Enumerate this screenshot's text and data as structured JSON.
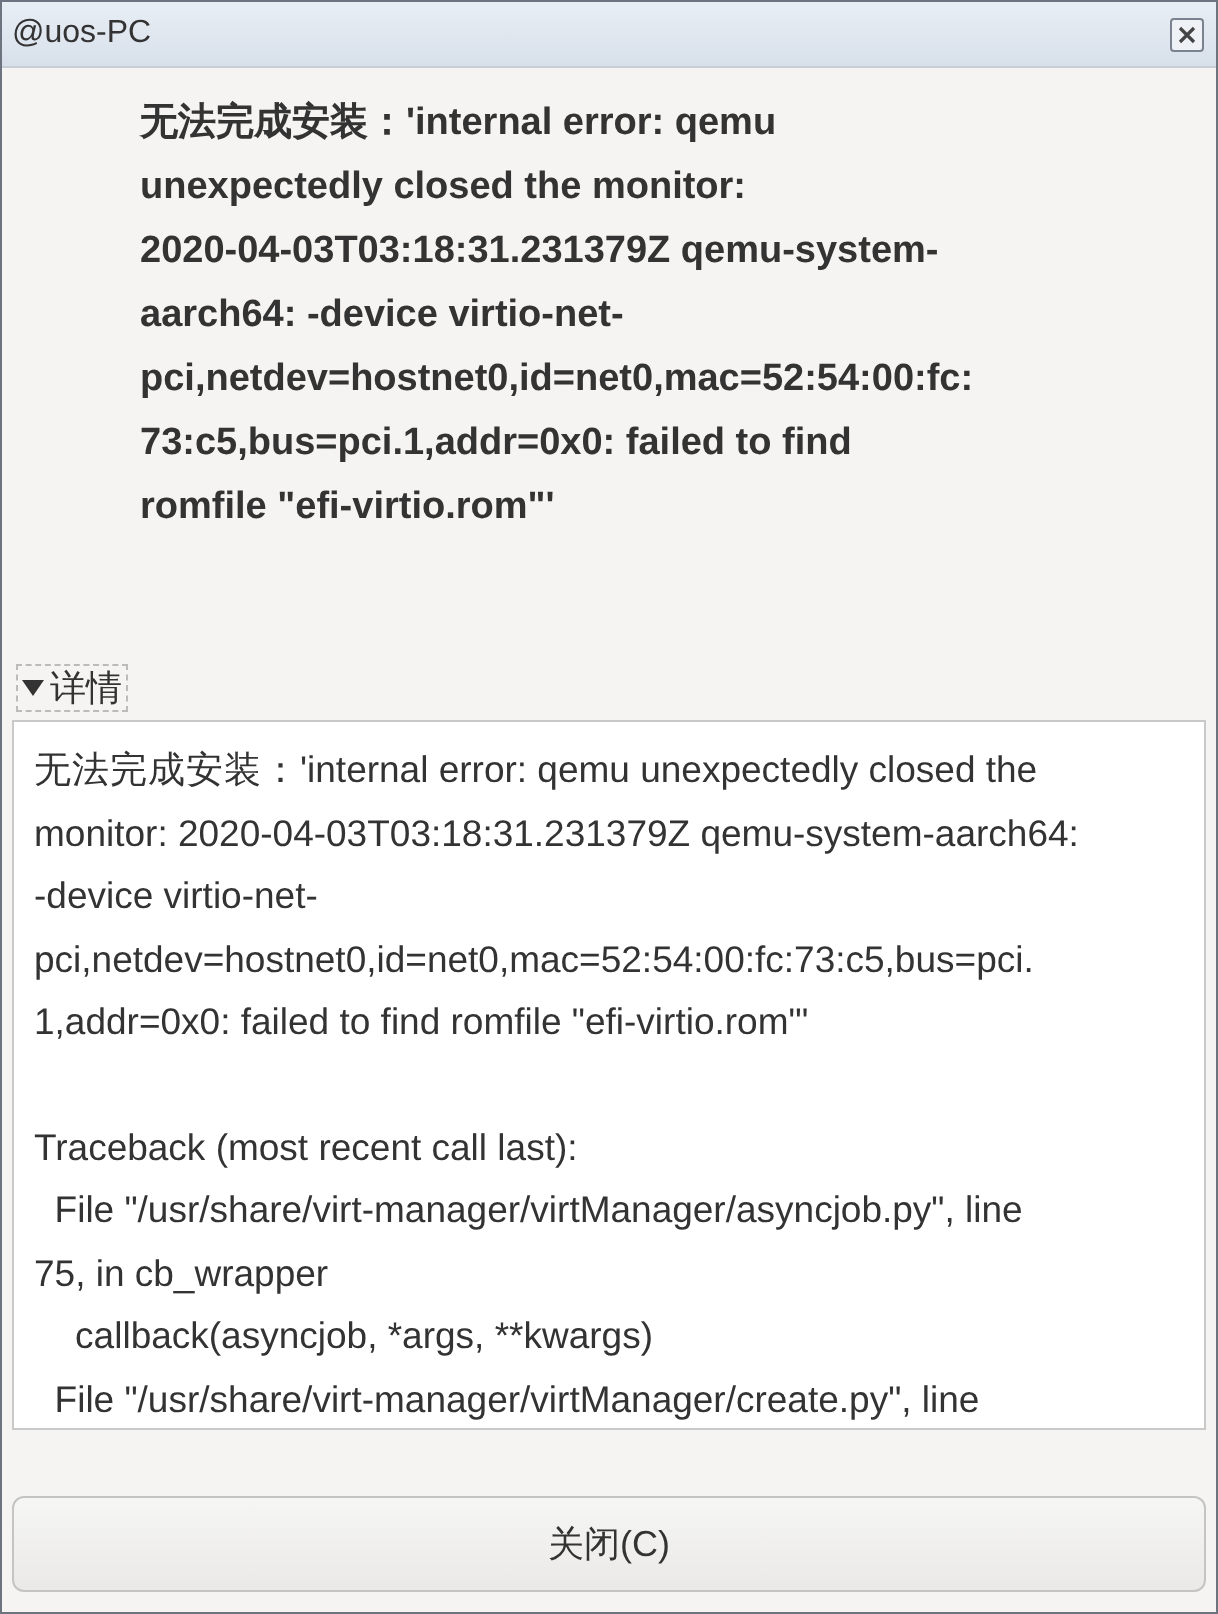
{
  "window": {
    "title": "@uos-PC"
  },
  "message": {
    "lines": [
      "无法完成安装：'internal error: qemu",
      "unexpectedly closed the monitor:",
      "2020-04-03T03:18:31.231379Z qemu-system-",
      "aarch64: -device virtio-net-",
      "pci,netdev=hostnet0,id=net0,mac=52:54:00:fc:",
      "73:c5,bus=pci.1,addr=0x0: failed to find",
      "romfile \"efi-virtio.rom\"'"
    ]
  },
  "details": {
    "label": "详情",
    "expanded": true,
    "blocks": [
      {
        "lines": [
          "无法完成安装：'internal error: qemu unexpectedly closed the",
          "monitor: 2020-04-03T03:18:31.231379Z qemu-system-aarch64:",
          "-device virtio-net-",
          "pci,netdev=hostnet0,id=net0,mac=52:54:00:fc:73:c5,bus=pci.",
          "1,addr=0x0: failed to find romfile \"efi-virtio.rom\"'"
        ]
      },
      {
        "lines": [
          "Traceback (most recent call last):",
          "  File \"/usr/share/virt-manager/virtManager/asyncjob.py\", line",
          "75, in cb_wrapper",
          "    callback(asyncjob, *args, **kwargs)",
          "  File \"/usr/share/virt-manager/virtManager/create.py\", line"
        ]
      }
    ]
  },
  "buttons": [
    {
      "label": "关闭(C)"
    }
  ]
}
